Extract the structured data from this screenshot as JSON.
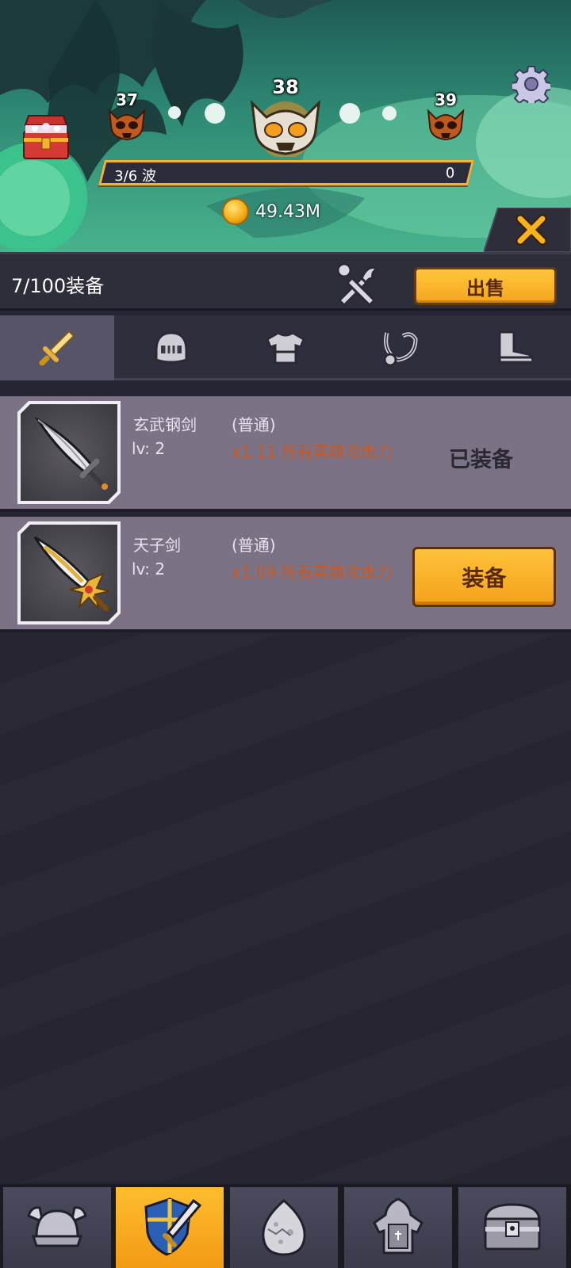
{
  "stage": {
    "prev": "37",
    "current": "38",
    "next": "39"
  },
  "wave": {
    "progress": "3/6 波",
    "count": "0"
  },
  "gold": "49.43M",
  "inventory": {
    "count": "7/100装备",
    "sell_label": "出售"
  },
  "category_tabs": [
    {
      "name": "weapon",
      "icon": "sword-icon",
      "active": true
    },
    {
      "name": "helmet",
      "icon": "helmet-icon",
      "active": false
    },
    {
      "name": "armor",
      "icon": "armor-icon",
      "active": false
    },
    {
      "name": "necklace",
      "icon": "necklace-icon",
      "active": false
    },
    {
      "name": "boots",
      "icon": "boots-icon",
      "active": false
    }
  ],
  "items": [
    {
      "name": "玄武钢剑",
      "level": "lv: 2",
      "rarity": "(普通)",
      "bonus": "x1.11 所有英雄攻击力",
      "status": "已装备",
      "equipped": true
    },
    {
      "name": "天子剑",
      "level": "lv: 2",
      "rarity": "(普通)",
      "bonus": "x1.09 所有英雄攻击力",
      "action": "装备",
      "equipped": false
    }
  ],
  "bottom_nav": [
    {
      "icon": "viking-helmet-icon",
      "active": false
    },
    {
      "icon": "shield-sword-icon",
      "active": true
    },
    {
      "icon": "egg-icon",
      "active": false
    },
    {
      "icon": "knight-armor-icon",
      "active": false
    },
    {
      "icon": "treasure-chest-icon",
      "active": false
    }
  ],
  "colors": {
    "accent": "#f5a51d",
    "panel": "#2e2d3a",
    "item_row": "#7b7286",
    "bonus_text": "#c45a28"
  }
}
